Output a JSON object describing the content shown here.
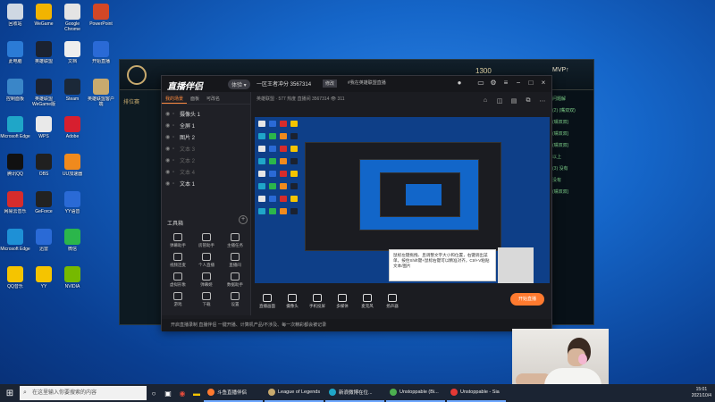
{
  "desktop": {
    "icons": [
      {
        "label": "回收站",
        "color": "#cfd8e3"
      },
      {
        "label": "此电脑",
        "color": "#2b7bd6"
      },
      {
        "label": "控制面板",
        "color": "#3a86c8"
      },
      {
        "label": "Microsoft Edge",
        "color": "#1fa6c8"
      },
      {
        "label": "腾讯QQ",
        "color": "#111111"
      },
      {
        "label": "网易云音乐",
        "color": "#d62c2c"
      },
      {
        "label": "Microsoft Edge",
        "color": "#1e90d6"
      },
      {
        "label": "QQ音乐",
        "color": "#f5c400"
      },
      {
        "label": "WeGame",
        "color": "#f2b400"
      },
      {
        "label": "英雄联盟",
        "color": "#1b2230"
      },
      {
        "label": "英雄联盟 WeGame版",
        "color": "#1b2230"
      },
      {
        "label": "WPS",
        "color": "#e9e9e9"
      },
      {
        "label": "OBS",
        "color": "#202020"
      },
      {
        "label": "GeForce",
        "color": "#222"
      },
      {
        "label": "迅雷",
        "color": "#2a6ad6"
      },
      {
        "label": "YY",
        "color": "#f5c400"
      },
      {
        "label": "Google Chrome",
        "color": "#e4e4e4"
      },
      {
        "label": "文档",
        "color": "#eeeeee"
      },
      {
        "label": "Steam",
        "color": "#1b2838"
      },
      {
        "label": "Adobe",
        "color": "#d71f2f"
      },
      {
        "label": "UU加速器",
        "color": "#f08a1d"
      },
      {
        "label": "YY语音",
        "color": "#2a6ad6"
      },
      {
        "label": "微信",
        "color": "#2bb64b"
      },
      {
        "label": "NVIDIA",
        "color": "#76b900"
      },
      {
        "label": "PowerPoint",
        "color": "#d24726"
      },
      {
        "label": "开始直播",
        "color": "#2a6ad6"
      },
      {
        "label": "英雄联盟客户端",
        "color": "#c8aa6e"
      }
    ]
  },
  "lol_client": {
    "rp": "1300",
    "mvp_text": "MVP↑",
    "left_tab": "排位赛",
    "chat": [
      "问题解",
      "(2) (嘴双双)",
      "(嘴双双)",
      "(嘴双双)",
      "(嘴双双)",
      "以上",
      "(3) 没有",
      "没有",
      "(嘴双双)"
    ]
  },
  "stream_app": {
    "logo_text": "直播伴侣",
    "version": "体验 ▾",
    "room_title": "一区王者冲分 3567314",
    "room_badge": "修改",
    "room_tag": "#我在英雄联盟直播",
    "sub_info": "英雄联盟 · 577 热度   直播间 3567314   👁 311",
    "tabs": [
      "我的场景",
      "面板",
      "可改名"
    ],
    "sources": [
      {
        "name": "摄像头 1",
        "dim": false
      },
      {
        "name": "全屏 1",
        "dim": false
      },
      {
        "name": "图片 2",
        "dim": false
      },
      {
        "name": "文本 3",
        "dim": true
      },
      {
        "name": "文本 2",
        "dim": true
      },
      {
        "name": "文本 4",
        "dim": true
      },
      {
        "name": "文本 1",
        "dim": false
      }
    ],
    "toolbox_title": "工具箱",
    "tools": [
      "弹幕助手",
      "房管助手",
      "主播任务",
      "视频连麦",
      "个人直播",
      "直播间",
      "虚拟形象",
      "弹幕姬",
      "数据助手",
      "游戏",
      "下载",
      "设置"
    ],
    "bottom_actions": [
      "直播画面",
      "摄像头",
      "手机投屏",
      "多媒体",
      "麦克风",
      "扬声器"
    ],
    "start_button": "开始直播",
    "tooltip": "鼠标左键拖拽、且调整文字大小和位置，右键调出菜单，按住Shift键+鼠标右键可以精准对齐，Ctrl+V粘贴文本/图片",
    "notice": "开启直播录制 直播伴侣 一键开播、计算机产品/不涉及、每一次精彩都会被记录"
  },
  "taskbar": {
    "search_placeholder": "在这里输入你要搜索的内容",
    "apps": [
      {
        "label": "斗鱼直播伴侣",
        "color": "#ff7a2f"
      },
      {
        "label": "League of Legends",
        "color": "#c8aa6e"
      },
      {
        "label": "新浪微博在位...",
        "color": "#1fa6c8"
      },
      {
        "label": "Unstoppable (Bi...",
        "color": "#4caf50"
      },
      {
        "label": "Unstoppable - Sia",
        "color": "#e53935"
      }
    ],
    "time": "15:01",
    "date": "2021/10/4"
  }
}
